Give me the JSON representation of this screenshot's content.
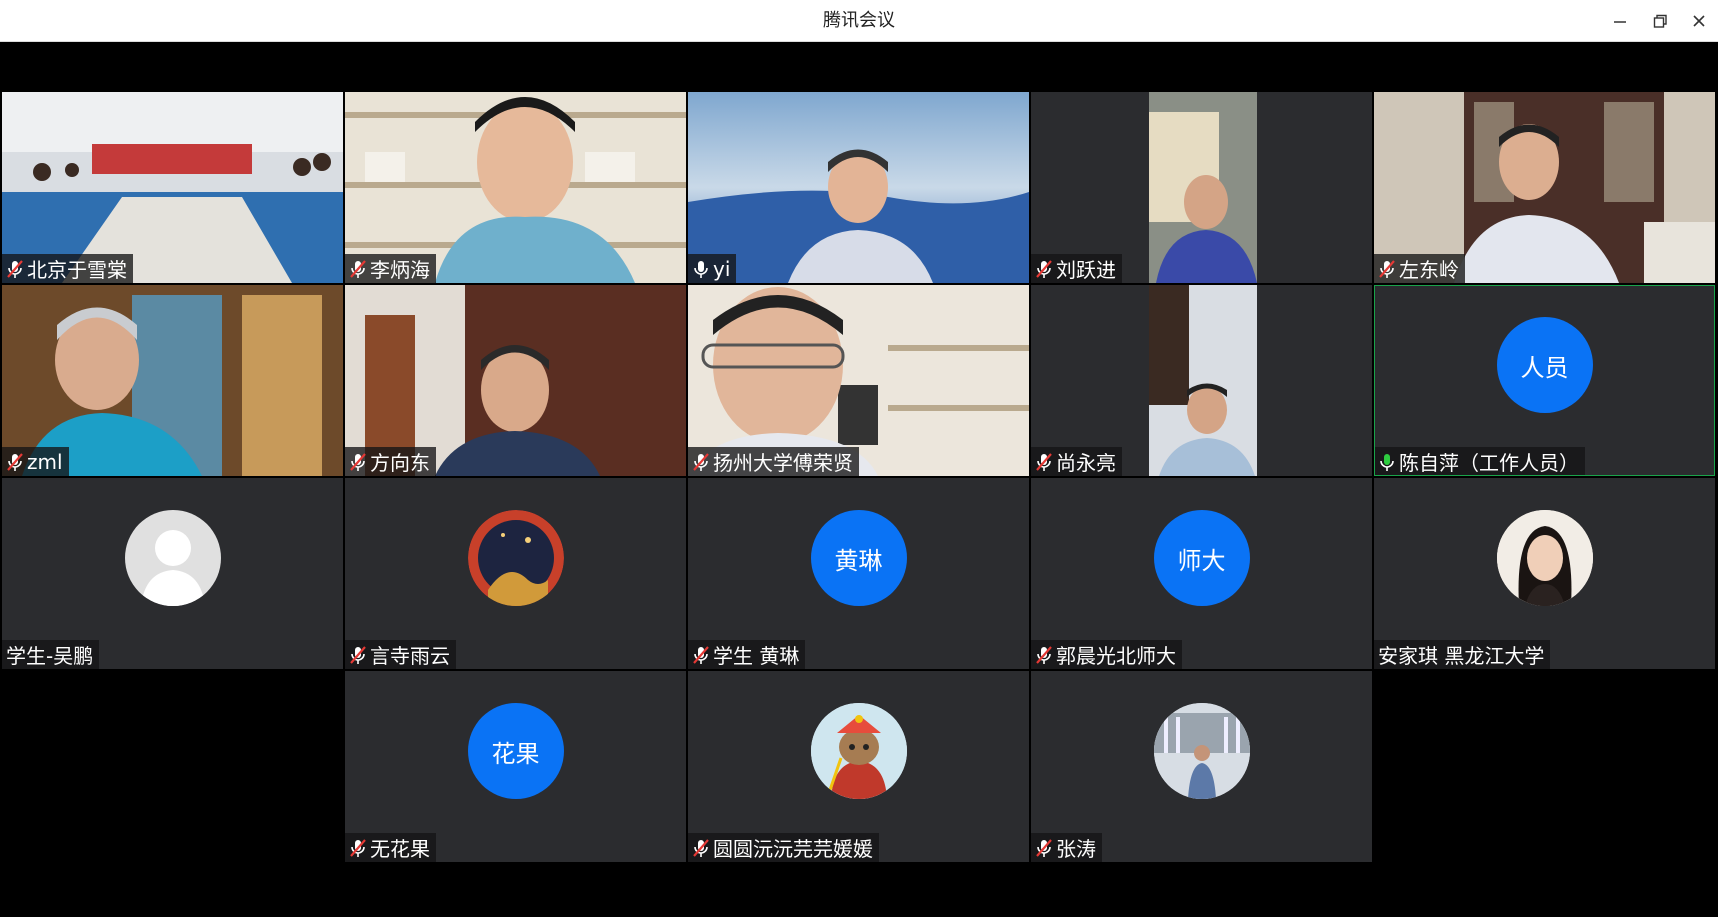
{
  "window": {
    "title": "腾讯会议",
    "icons": [
      "minimize-icon",
      "restore-icon",
      "close-icon"
    ]
  },
  "colors": {
    "accent": "#0a73f5",
    "active_border": "#1aa34a",
    "tile_bg": "#2b2c2f",
    "muted_mic": "#e53935",
    "unmuted_mic": "#2ecc40"
  },
  "participants": [
    {
      "name": "北京于雪棠",
      "mic": "muted",
      "video": true
    },
    {
      "name": "李炳海",
      "mic": "muted",
      "video": true
    },
    {
      "name": "yi",
      "mic": "unmuted",
      "video": true
    },
    {
      "name": "刘跃进",
      "mic": "muted",
      "video": true
    },
    {
      "name": "左东岭",
      "mic": "muted",
      "video": true
    },
    {
      "name": "zml",
      "mic": "muted",
      "video": true
    },
    {
      "name": "方向东",
      "mic": "muted",
      "video": true
    },
    {
      "name": "扬州大学傅荣贤",
      "mic": "muted",
      "video": true
    },
    {
      "name": "尚永亮",
      "mic": "muted",
      "video": true
    },
    {
      "name": "陈自萍（工作人员）",
      "mic": "speaking",
      "video": false,
      "avatar_text": "人员",
      "active": true
    },
    {
      "name": "学生-吴鹏",
      "mic": "none",
      "video": false,
      "avatar": "default-avatar"
    },
    {
      "name": "言寺雨云",
      "mic": "muted",
      "video": false,
      "avatar": "photo-avatar"
    },
    {
      "name": "学生 黄琳",
      "mic": "muted",
      "video": false,
      "avatar_text": "黄琳"
    },
    {
      "name": "郭晨光北师大",
      "mic": "muted",
      "video": false,
      "avatar_text": "师大"
    },
    {
      "name": "安家琪 黑龙江大学",
      "mic": "none",
      "video": false,
      "avatar": "photo-avatar"
    },
    {
      "name": "无花果",
      "mic": "muted",
      "video": false,
      "avatar_text": "花果"
    },
    {
      "name": "圆圆沅沅芫芫媛媛",
      "mic": "muted",
      "video": false,
      "avatar": "cartoon-avatar"
    },
    {
      "name": "张涛",
      "mic": "muted",
      "video": false,
      "avatar": "photo-avatar"
    }
  ]
}
